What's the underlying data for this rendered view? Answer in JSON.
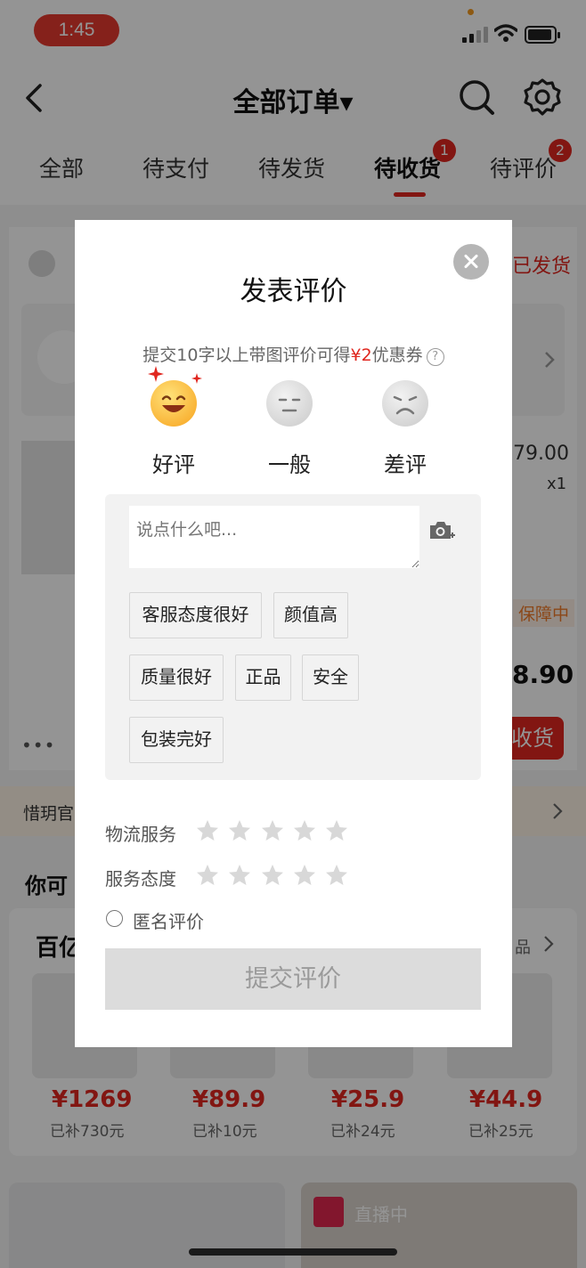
{
  "status_bar": {
    "time": "1:45"
  },
  "nav": {
    "title": "全部订单▾"
  },
  "tabs": [
    {
      "label": "全部"
    },
    {
      "label": "待支付"
    },
    {
      "label": "待发货"
    },
    {
      "label": "待收货",
      "badge": "1",
      "active": true
    },
    {
      "label": "待评价",
      "badge": "2"
    }
  ],
  "background": {
    "order_status": "已发货",
    "item_price_partial": "79.00",
    "item_qty": "x1",
    "guarantee_partial": "保障中",
    "total_partial": "8.90",
    "confirm_partial": "收货",
    "store_partial": "惜玥官",
    "recommend_partial": "你可",
    "section_partial": "百亿",
    "section_more_partial": "品",
    "live_label": "直播中",
    "products": [
      {
        "price": "¥1269",
        "subsidy": "已补730元"
      },
      {
        "price": "¥89.9",
        "subsidy": "已补10元"
      },
      {
        "price": "¥25.9",
        "subsidy": "已补24元"
      },
      {
        "price": "¥44.9",
        "subsidy": "已补25元"
      }
    ]
  },
  "modal": {
    "title": "发表评价",
    "promo_prefix": "提交10字以上带图评价可得",
    "promo_amount": "¥2",
    "promo_suffix": "优惠券",
    "ratings": [
      {
        "label": "好评"
      },
      {
        "label": "一般"
      },
      {
        "label": "差评"
      }
    ],
    "review_placeholder": "说点什么吧...",
    "tags": [
      "客服态度很好",
      "颜值高",
      "质量很好",
      "正品",
      "安全",
      "包装完好"
    ],
    "logistics_label": "物流服务",
    "service_label": "服务态度",
    "star_color": "#d8d8d8",
    "anonymous_label": "匿名评价",
    "submit_label": "提交评价"
  }
}
